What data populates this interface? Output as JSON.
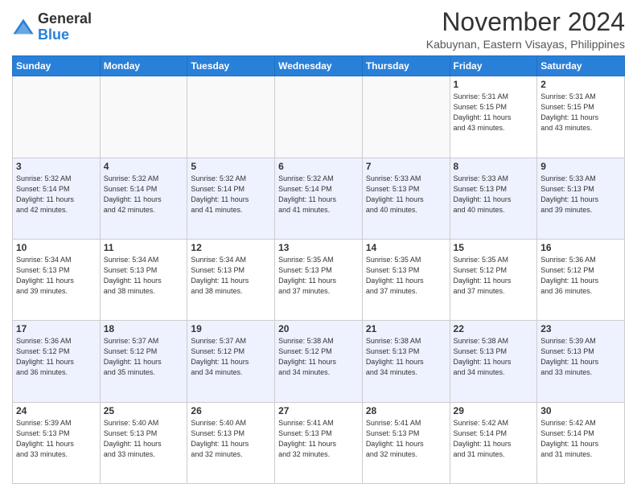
{
  "header": {
    "logo_general": "General",
    "logo_blue": "Blue",
    "month_title": "November 2024",
    "location": "Kabuynan, Eastern Visayas, Philippines"
  },
  "weekdays": [
    "Sunday",
    "Monday",
    "Tuesday",
    "Wednesday",
    "Thursday",
    "Friday",
    "Saturday"
  ],
  "weeks": [
    [
      {
        "day": "",
        "info": ""
      },
      {
        "day": "",
        "info": ""
      },
      {
        "day": "",
        "info": ""
      },
      {
        "day": "",
        "info": ""
      },
      {
        "day": "",
        "info": ""
      },
      {
        "day": "1",
        "info": "Sunrise: 5:31 AM\nSunset: 5:15 PM\nDaylight: 11 hours\nand 43 minutes."
      },
      {
        "day": "2",
        "info": "Sunrise: 5:31 AM\nSunset: 5:15 PM\nDaylight: 11 hours\nand 43 minutes."
      }
    ],
    [
      {
        "day": "3",
        "info": "Sunrise: 5:32 AM\nSunset: 5:14 PM\nDaylight: 11 hours\nand 42 minutes."
      },
      {
        "day": "4",
        "info": "Sunrise: 5:32 AM\nSunset: 5:14 PM\nDaylight: 11 hours\nand 42 minutes."
      },
      {
        "day": "5",
        "info": "Sunrise: 5:32 AM\nSunset: 5:14 PM\nDaylight: 11 hours\nand 41 minutes."
      },
      {
        "day": "6",
        "info": "Sunrise: 5:32 AM\nSunset: 5:14 PM\nDaylight: 11 hours\nand 41 minutes."
      },
      {
        "day": "7",
        "info": "Sunrise: 5:33 AM\nSunset: 5:13 PM\nDaylight: 11 hours\nand 40 minutes."
      },
      {
        "day": "8",
        "info": "Sunrise: 5:33 AM\nSunset: 5:13 PM\nDaylight: 11 hours\nand 40 minutes."
      },
      {
        "day": "9",
        "info": "Sunrise: 5:33 AM\nSunset: 5:13 PM\nDaylight: 11 hours\nand 39 minutes."
      }
    ],
    [
      {
        "day": "10",
        "info": "Sunrise: 5:34 AM\nSunset: 5:13 PM\nDaylight: 11 hours\nand 39 minutes."
      },
      {
        "day": "11",
        "info": "Sunrise: 5:34 AM\nSunset: 5:13 PM\nDaylight: 11 hours\nand 38 minutes."
      },
      {
        "day": "12",
        "info": "Sunrise: 5:34 AM\nSunset: 5:13 PM\nDaylight: 11 hours\nand 38 minutes."
      },
      {
        "day": "13",
        "info": "Sunrise: 5:35 AM\nSunset: 5:13 PM\nDaylight: 11 hours\nand 37 minutes."
      },
      {
        "day": "14",
        "info": "Sunrise: 5:35 AM\nSunset: 5:13 PM\nDaylight: 11 hours\nand 37 minutes."
      },
      {
        "day": "15",
        "info": "Sunrise: 5:35 AM\nSunset: 5:12 PM\nDaylight: 11 hours\nand 37 minutes."
      },
      {
        "day": "16",
        "info": "Sunrise: 5:36 AM\nSunset: 5:12 PM\nDaylight: 11 hours\nand 36 minutes."
      }
    ],
    [
      {
        "day": "17",
        "info": "Sunrise: 5:36 AM\nSunset: 5:12 PM\nDaylight: 11 hours\nand 36 minutes."
      },
      {
        "day": "18",
        "info": "Sunrise: 5:37 AM\nSunset: 5:12 PM\nDaylight: 11 hours\nand 35 minutes."
      },
      {
        "day": "19",
        "info": "Sunrise: 5:37 AM\nSunset: 5:12 PM\nDaylight: 11 hours\nand 34 minutes."
      },
      {
        "day": "20",
        "info": "Sunrise: 5:38 AM\nSunset: 5:12 PM\nDaylight: 11 hours\nand 34 minutes."
      },
      {
        "day": "21",
        "info": "Sunrise: 5:38 AM\nSunset: 5:13 PM\nDaylight: 11 hours\nand 34 minutes."
      },
      {
        "day": "22",
        "info": "Sunrise: 5:38 AM\nSunset: 5:13 PM\nDaylight: 11 hours\nand 34 minutes."
      },
      {
        "day": "23",
        "info": "Sunrise: 5:39 AM\nSunset: 5:13 PM\nDaylight: 11 hours\nand 33 minutes."
      }
    ],
    [
      {
        "day": "24",
        "info": "Sunrise: 5:39 AM\nSunset: 5:13 PM\nDaylight: 11 hours\nand 33 minutes."
      },
      {
        "day": "25",
        "info": "Sunrise: 5:40 AM\nSunset: 5:13 PM\nDaylight: 11 hours\nand 33 minutes."
      },
      {
        "day": "26",
        "info": "Sunrise: 5:40 AM\nSunset: 5:13 PM\nDaylight: 11 hours\nand 32 minutes."
      },
      {
        "day": "27",
        "info": "Sunrise: 5:41 AM\nSunset: 5:13 PM\nDaylight: 11 hours\nand 32 minutes."
      },
      {
        "day": "28",
        "info": "Sunrise: 5:41 AM\nSunset: 5:13 PM\nDaylight: 11 hours\nand 32 minutes."
      },
      {
        "day": "29",
        "info": "Sunrise: 5:42 AM\nSunset: 5:14 PM\nDaylight: 11 hours\nand 31 minutes."
      },
      {
        "day": "30",
        "info": "Sunrise: 5:42 AM\nSunset: 5:14 PM\nDaylight: 11 hours\nand 31 minutes."
      }
    ]
  ]
}
